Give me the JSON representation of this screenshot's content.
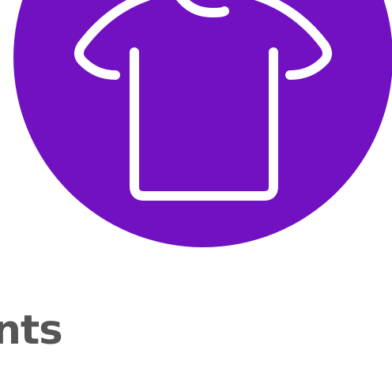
{
  "category_badge": {
    "icon": "t-shirt-icon",
    "circle_color": "#7111C1",
    "icon_color": "#FFFFFF"
  },
  "section": {
    "label": "ents",
    "color": "#555555"
  }
}
